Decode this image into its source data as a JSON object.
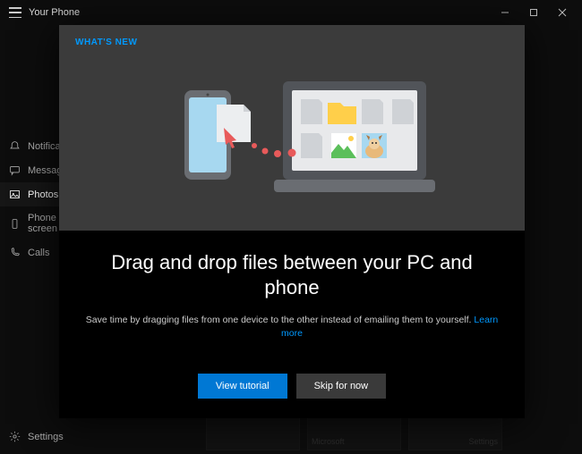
{
  "titlebar": {
    "app_title": "Your Phone"
  },
  "sidebar": {
    "items": [
      {
        "label": "Notifications"
      },
      {
        "label": "Messages"
      },
      {
        "label": "Photos"
      },
      {
        "label": "Phone screen"
      },
      {
        "label": "Calls"
      }
    ],
    "settings_label": "Settings"
  },
  "dialog": {
    "whats_new": "WHAT'S NEW",
    "headline": "Drag and drop files between your PC and phone",
    "subtext": "Save time by dragging files from one device to the other instead of emailing them to yourself.",
    "learn_more": "Learn more",
    "primary_btn": "View tutorial",
    "secondary_btn": "Skip for now"
  },
  "bg": {
    "card2": "Microsoft",
    "card3": "Settings"
  }
}
